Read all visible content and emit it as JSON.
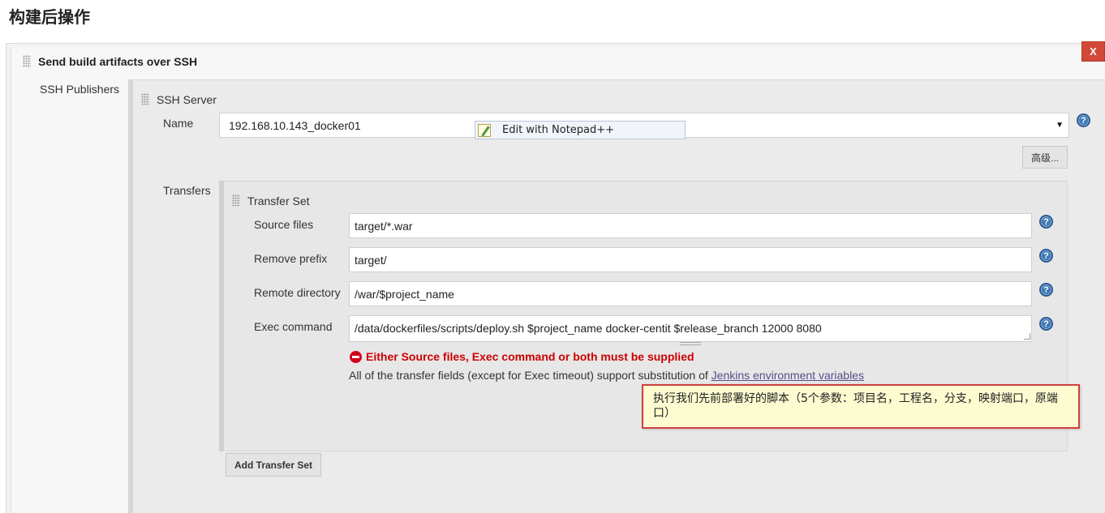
{
  "page_title": "构建后操作",
  "publisher": {
    "title": "Send build artifacts over SSH",
    "delete_label": "X",
    "publishers_label": "SSH Publishers"
  },
  "ssh_server": {
    "title": "SSH Server",
    "name_label": "Name",
    "name_value": "192.168.10.143_docker01",
    "advanced_label": "高级...",
    "transfers_label": "Transfers"
  },
  "context_popup": {
    "label": "Edit with Notepad++"
  },
  "transfer_set": {
    "title": "Transfer Set",
    "source_files_label": "Source files",
    "source_files_value": "target/*.war",
    "remove_prefix_label": "Remove prefix",
    "remove_prefix_value": "target/",
    "remote_directory_label": "Remote directory",
    "remote_directory_value": "/war/$project_name",
    "exec_command_label": "Exec command",
    "exec_command_value": "/data/dockerfiles/scripts/deploy.sh $project_name docker-centit $release_branch 12000 8080",
    "error_text": "Either Source files, Exec command or both must be supplied",
    "info_text": "All of the transfer fields (except for Exec timeout) support substitution of ",
    "info_link": "Jenkins environment variables",
    "add_button_label": "Add Transfer Set"
  },
  "annotation": {
    "text": "执行我们先前部署好的脚本（5个参数：项目名，工程名，分支，映射端口，原端口）"
  },
  "help_glyph": "?",
  "dropdown_arrow": "▼",
  "colors": {
    "delete_button": "#d24939",
    "error": "#cc0000",
    "help_icon": "#3f78b6",
    "note_border": "#d14040",
    "note_background": "#fdfbd0"
  }
}
